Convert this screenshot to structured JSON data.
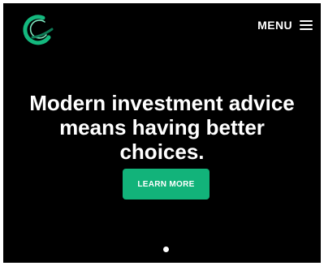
{
  "header": {
    "logo_icon": "crescent-swoosh-logo-icon",
    "menu_label": "MENU",
    "menu_icon": "hamburger-menu-icon"
  },
  "hero": {
    "headline_line1": "Modern investment advice",
    "headline_line2": "means having better",
    "headline_line3": "choices.",
    "cta_label": "LEARN MORE"
  },
  "carousel": {
    "slide_count_visible": 1,
    "active_index": 0
  },
  "colors": {
    "background": "#000000",
    "accent": "#12b37a",
    "text": "#ffffff"
  }
}
